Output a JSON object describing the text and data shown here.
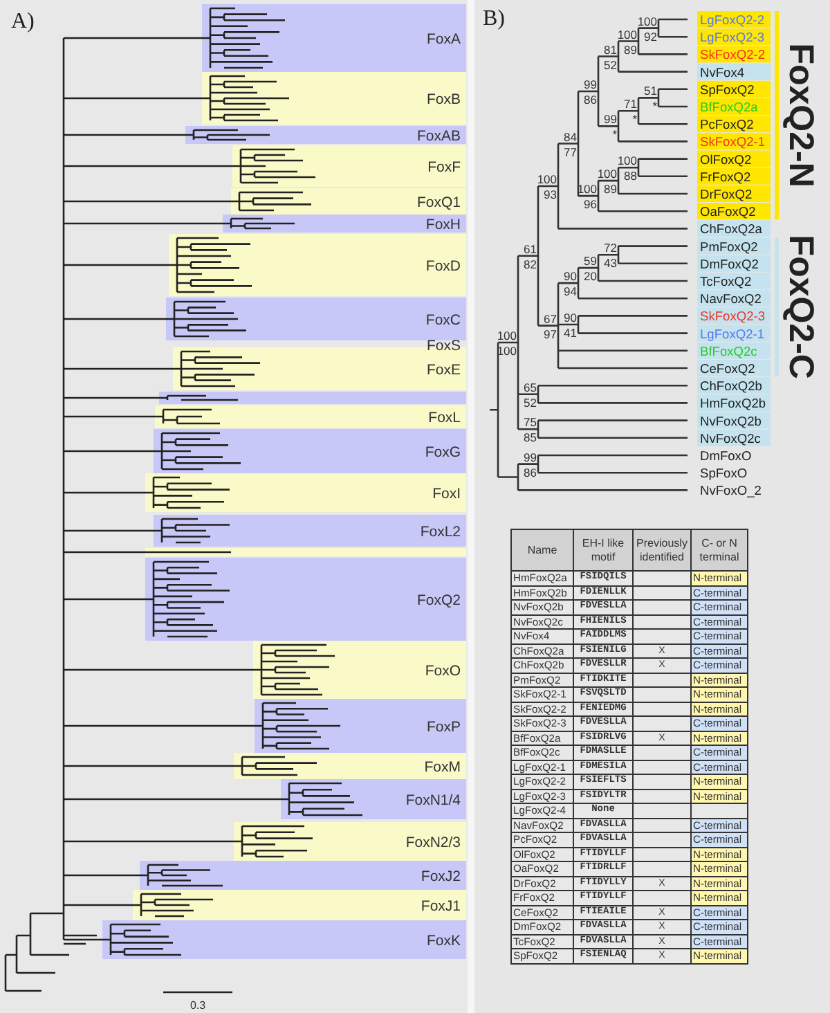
{
  "panel_a": {
    "label": "A)",
    "scale_label": "0.3",
    "clades": [
      {
        "name": "FoxA",
        "color": "#c8c8f8"
      },
      {
        "name": "FoxB",
        "color": "#fafac8"
      },
      {
        "name": "FoxAB",
        "color": "#c8c8f8"
      },
      {
        "name": "FoxF",
        "color": "#fafac8"
      },
      {
        "name": "FoxQ1",
        "color": "#fafac8"
      },
      {
        "name": "FoxH",
        "color": "#c8c8f8"
      },
      {
        "name": "FoxD",
        "color": "#fafac8"
      },
      {
        "name": "FoxC",
        "color": "#c8c8f8"
      },
      {
        "name": "FoxS"
      },
      {
        "name": "FoxE",
        "color": "#fafac8"
      },
      {
        "color": "#c8c8f8"
      },
      {
        "name": "FoxL",
        "color": "#fafac8"
      },
      {
        "name": "FoxG",
        "color": "#c8c8f8"
      },
      {
        "name": "FoxI",
        "color": "#fafac8"
      },
      {
        "name": "FoxL2",
        "color": "#c8c8f8"
      },
      {
        "color": "#fafac8"
      },
      {
        "name": "FoxQ2",
        "color": "#c8c8f8"
      },
      {
        "name": "FoxO",
        "color": "#fafac8"
      },
      {
        "name": "FoxP",
        "color": "#c8c8f8"
      },
      {
        "name": "FoxM",
        "color": "#fafac8"
      },
      {
        "name": "FoxN1/4",
        "color": "#c8c8f8"
      },
      {
        "name": "FoxN2/3",
        "color": "#fafac8"
      },
      {
        "name": "FoxJ2",
        "color": "#c8c8f8"
      },
      {
        "name": "FoxJ1",
        "color": "#fafac8"
      },
      {
        "name": "FoxK",
        "color": "#c8c8f8"
      }
    ]
  },
  "panel_b": {
    "label": "B)",
    "groups": [
      {
        "label": "FoxQ2-N",
        "color": "#ffe600"
      },
      {
        "label": "FoxQ2-C",
        "color": "#c5e3ee"
      }
    ],
    "tree": {
      "children": [
        {
          "support": [
            "100",
            "100"
          ],
          "children": [
            {
              "support": [
                "61",
                "82"
              ],
              "children": [
                {
                  "support": [
                    "100",
                    "93"
                  ],
                  "children": [
                    {
                      "support": [
                        "84",
                        "77"
                      ],
                      "children": [
                        {
                          "support": [
                            "99",
                            "86"
                          ],
                          "children": [
                            {
                              "support": [
                                "81",
                                "52"
                              ],
                              "children": [
                                {
                                  "support": [
                                    "100",
                                    "89"
                                  ],
                                  "children": [
                                    {
                                      "support": [
                                        "100",
                                        "92"
                                      ],
                                      "children": [
                                        {
                                          "name": "LgFoxQ2-2",
                                          "color": "#5577ee",
                                          "kind": "n"
                                        },
                                        {
                                          "name": "LgFoxQ2-3",
                                          "color": "#5577ee",
                                          "kind": "n"
                                        }
                                      ]
                                    },
                                    {
                                      "name": "SkFoxQ2-2",
                                      "color": "#ee3322",
                                      "kind": "n"
                                    }
                                  ]
                                },
                                {
                                  "name": "NvFox4",
                                  "color": "#222222",
                                  "kind": "c"
                                }
                              ]
                            },
                            {
                              "support": [
                                "99",
                                "*"
                              ],
                              "children": [
                                {
                                  "support": [
                                    "71",
                                    "*"
                                  ],
                                  "children": [
                                    {
                                      "support": [
                                        "51",
                                        "*"
                                      ],
                                      "children": [
                                        {
                                          "name": "SpFoxQ2",
                                          "color": "#222222",
                                          "kind": "n"
                                        },
                                        {
                                          "name": "BfFoxQ2a",
                                          "color": "#22cc22",
                                          "kind": "n"
                                        }
                                      ]
                                    },
                                    {
                                      "name": "PcFoxQ2",
                                      "color": "#222222",
                                      "kind": "n"
                                    }
                                  ]
                                },
                                {
                                  "name": "SkFoxQ2-1",
                                  "color": "#ee3322",
                                  "kind": "n"
                                }
                              ]
                            }
                          ]
                        },
                        {
                          "support": [
                            "100",
                            "96"
                          ],
                          "children": [
                            {
                              "support": [
                                "100",
                                "89"
                              ],
                              "children": [
                                {
                                  "support": [
                                    "100",
                                    "88"
                                  ],
                                  "children": [
                                    {
                                      "name": "OlFoxQ2",
                                      "color": "#222222",
                                      "kind": "n"
                                    },
                                    {
                                      "name": "FrFoxQ2",
                                      "color": "#222222",
                                      "kind": "n"
                                    }
                                  ]
                                },
                                {
                                  "name": "DrFoxQ2",
                                  "color": "#222222",
                                  "kind": "n"
                                }
                              ]
                            },
                            {
                              "name": "OaFoxQ2",
                              "color": "#222222",
                              "kind": "n"
                            }
                          ]
                        }
                      ]
                    },
                    {
                      "name": "ChFoxQ2a",
                      "color": "#222222",
                      "kind": "c"
                    }
                  ]
                },
                {
                  "support": [
                    "67",
                    "97"
                  ],
                  "children": [
                    {
                      "support": [
                        "90",
                        "94"
                      ],
                      "children": [
                        {
                          "support": [
                            "59",
                            "20"
                          ],
                          "children": [
                            {
                              "support": [
                                "72",
                                "43"
                              ],
                              "children": [
                                {
                                  "name": "PmFoxQ2",
                                  "color": "#222222",
                                  "kind": "c"
                                },
                                {
                                  "name": "DmFoxQ2",
                                  "color": "#222222",
                                  "kind": "c"
                                }
                              ]
                            },
                            {
                              "name": "TcFoxQ2",
                              "color": "#222222",
                              "kind": "c"
                            }
                          ]
                        },
                        {
                          "name": "NavFoxQ2",
                          "color": "#222222",
                          "kind": "c"
                        }
                      ]
                    },
                    {
                      "support": [
                        "90",
                        "41"
                      ],
                      "children": [
                        {
                          "name": "SkFoxQ2-3",
                          "color": "#ee3322",
                          "kind": "c"
                        },
                        {
                          "name": "LgFoxQ2-1",
                          "color": "#5577ee",
                          "kind": "c"
                        }
                      ]
                    },
                    {
                      "name": "BfFoxQ2c",
                      "color": "#22cc22",
                      "kind": "c"
                    },
                    {
                      "name": "CeFoxQ2",
                      "color": "#222222",
                      "kind": "c"
                    }
                  ]
                }
              ]
            },
            {
              "support": [
                "65",
                "52"
              ],
              "children": [
                {
                  "name": "ChFoxQ2b",
                  "color": "#222222",
                  "kind": "c"
                },
                {
                  "name": "HmFoxQ2b",
                  "color": "#222222",
                  "kind": "c"
                }
              ]
            },
            {
              "support": [
                "75",
                "85"
              ],
              "children": [
                {
                  "name": "NvFoxQ2b",
                  "color": "#222222",
                  "kind": "c"
                },
                {
                  "name": "NvFoxQ2c",
                  "color": "#222222",
                  "kind": "c"
                }
              ]
            }
          ]
        },
        {
          "children": [
            {
              "support": [
                "99",
                "86"
              ],
              "children": [
                {
                  "name": "DmFoxO",
                  "color": "#222222"
                },
                {
                  "name": "SpFoxO",
                  "color": "#222222"
                }
              ]
            },
            {
              "name": "NvFoxO_2",
              "color": "#222222"
            }
          ]
        }
      ]
    }
  },
  "table": {
    "columns": [
      "Name",
      "EH-I like motif",
      "Previously identified",
      "C- or N terminal"
    ],
    "rows": [
      {
        "name": "HmFoxQ2a",
        "motif": "FSIDQILS",
        "terminal": "N-terminal",
        "kind": "n"
      },
      {
        "name": "HmFoxQ2b",
        "motif": "FDIENLLK",
        "terminal": "C-terminal",
        "kind": "c"
      },
      {
        "name": "NvFoxQ2b",
        "motif": "FDVESLLA",
        "terminal": "C-terminal",
        "kind": "c"
      },
      {
        "name": "NvFoxQ2c",
        "motif": "FHIENILS",
        "terminal": "C-terminal",
        "kind": "c"
      },
      {
        "name": "NvFox4",
        "motif": "FAIDDLMS",
        "terminal": "C-terminal",
        "kind": "c"
      },
      {
        "name": "ChFoxQ2a",
        "motif": "FSIENILG",
        "previously": "X",
        "terminal": "C-terminal",
        "kind": "c"
      },
      {
        "name": "ChFoxQ2b",
        "motif": "FDVESLLR",
        "previously": "X",
        "terminal": "C-terminal",
        "kind": "c"
      },
      {
        "name": "PmFoxQ2",
        "motif": "FTIDKITE",
        "terminal": "N-terminal",
        "kind": "n"
      },
      {
        "name": "SkFoxQ2-1",
        "motif": "FSVQSLTD",
        "terminal": "N-terminal",
        "kind": "n"
      },
      {
        "name": "SkFoxQ2-2",
        "motif": "FENIEDMG",
        "terminal": "N-terminal",
        "kind": "n"
      },
      {
        "name": "SkFoxQ2-3",
        "motif": "FDVESLLA",
        "terminal": "C-terminal",
        "kind": "c"
      },
      {
        "name": "BfFoxQ2a",
        "motif": "FSIDRLVG",
        "previously": "X",
        "terminal": "N-terminal",
        "kind": "n"
      },
      {
        "name": "BfFoxQ2c",
        "motif": "FDMASLLE",
        "terminal": "C-terminal",
        "kind": "c"
      },
      {
        "name": "LgFoxQ2-1",
        "motif": "FDMESILA",
        "terminal": "C-terminal",
        "kind": "c"
      },
      {
        "name": "LgFoxQ2-2",
        "motif": "FSIEFLTS",
        "terminal": "N-terminal",
        "kind": "n"
      },
      {
        "name": "LgFoxQ2-3",
        "motif": "FSIDYLTR",
        "terminal": "N-terminal",
        "kind": "n"
      },
      {
        "name": "LgFoxQ2-4",
        "motif": "None"
      },
      {
        "name": "NavFoxQ2",
        "motif": "FDVASLLA",
        "terminal": "C-terminal",
        "kind": "c"
      },
      {
        "name": "PcFoxQ2",
        "motif": "FDVASLLA",
        "terminal": "C-terminal",
        "kind": "c"
      },
      {
        "name": "OlFoxQ2",
        "motif": "FTIDYLLF",
        "terminal": "N-terminal",
        "kind": "n"
      },
      {
        "name": "OaFoxQ2",
        "motif": "FTIDRLLF",
        "terminal": "N-terminal",
        "kind": "n"
      },
      {
        "name": "DrFoxQ2",
        "motif": "FTIDYLLY",
        "previously": "X",
        "terminal": "N-terminal",
        "kind": "n"
      },
      {
        "name": "FrFoxQ2",
        "motif": "FTIDYLLF",
        "terminal": "N-terminal",
        "kind": "n"
      },
      {
        "name": "CeFoxQ2",
        "motif": "FTIEAILE",
        "previously": "X",
        "terminal": "C-terminal",
        "kind": "c"
      },
      {
        "name": "DmFoxQ2",
        "motif": "FDVASLLA",
        "previously": "X",
        "terminal": "C-terminal",
        "kind": "c"
      },
      {
        "name": "TcFoxQ2",
        "motif": "FDVASLLA",
        "previously": "X",
        "terminal": "C-terminal",
        "kind": "c"
      },
      {
        "name": "SpFoxQ2",
        "motif": "FSIENLAQ",
        "previously": "X",
        "terminal": "N-terminal",
        "kind": "n"
      }
    ]
  }
}
